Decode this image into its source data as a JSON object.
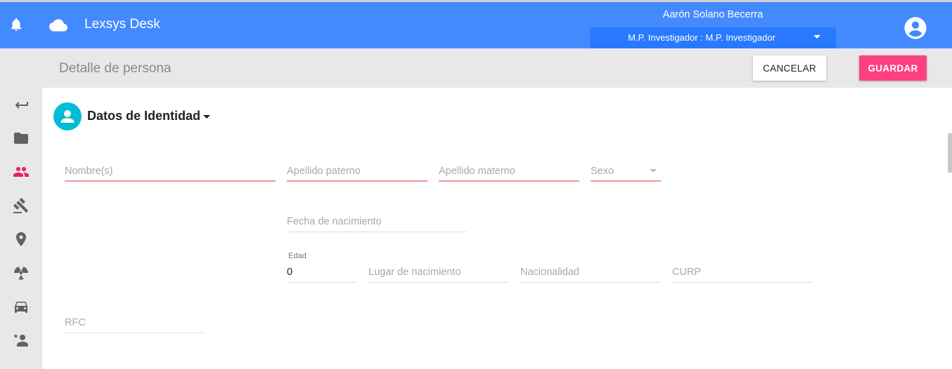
{
  "header": {
    "app_title": "Lexsys Desk",
    "user_name": "Aarón Solano Becerra",
    "role": "M.P. Investigador : M.P. Investigador",
    "bg_color": "#448aff",
    "icons": [
      "bell-icon",
      "cloud-icon",
      "account-circle-icon",
      "caret-down-icon"
    ]
  },
  "toolbar": {
    "page_title": "Detalle de persona",
    "cancel_label": "CANCELAR",
    "save_label": "GUARDAR",
    "save_color": "#ff4081"
  },
  "sidenav": {
    "items": [
      {
        "icon": "back-arrow-icon",
        "active": false
      },
      {
        "icon": "folder-icon",
        "active": false
      },
      {
        "icon": "people-icon",
        "active": true,
        "color": "#e91e63"
      },
      {
        "icon": "gavel-icon",
        "active": false
      },
      {
        "icon": "location-pin-icon",
        "active": false
      },
      {
        "icon": "hazard-icon",
        "active": false
      },
      {
        "icon": "car-icon",
        "active": false
      },
      {
        "icon": "person-star-icon",
        "active": false
      }
    ]
  },
  "section": {
    "title": "Datos de Identidad",
    "icon": "person-icon",
    "icon_color": "#00bcd4"
  },
  "form": {
    "nombre": {
      "placeholder": "Nombre(s)",
      "value": ""
    },
    "apellido_paterno": {
      "placeholder": "Apellido paterno",
      "value": ""
    },
    "apellido_materno": {
      "placeholder": "Apellido materno",
      "value": ""
    },
    "sexo": {
      "placeholder": "Sexo",
      "value": ""
    },
    "fecha_nacimiento": {
      "placeholder": "Fecha de nacimiento",
      "value": ""
    },
    "edad": {
      "label": "Edad",
      "value": "0"
    },
    "lugar_nacimiento": {
      "placeholder": "Lugar de nacimiento",
      "value": ""
    },
    "nacionalidad": {
      "placeholder": "Nacionalidad",
      "value": ""
    },
    "curp": {
      "placeholder": "CURP",
      "value": ""
    },
    "rfc": {
      "placeholder": "RFC",
      "value": ""
    }
  }
}
